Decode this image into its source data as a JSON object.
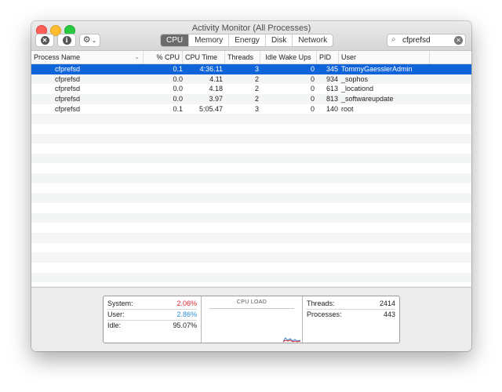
{
  "window": {
    "title": "Activity Monitor (All Processes)"
  },
  "toolbar": {
    "close_glyph": "✕",
    "info_glyph": "i",
    "gear_glyph": "⚙",
    "chevron_glyph": "⌄",
    "tabs": [
      {
        "label": "CPU",
        "active": true
      },
      {
        "label": "Memory",
        "active": false
      },
      {
        "label": "Energy",
        "active": false
      },
      {
        "label": "Disk",
        "active": false
      },
      {
        "label": "Network",
        "active": false
      }
    ],
    "search": {
      "value": "cfprefsd",
      "icon_glyph": "⌕",
      "clear_glyph": "✕"
    }
  },
  "table": {
    "columns": [
      "Process Name",
      "% CPU",
      "CPU Time",
      "Threads",
      "Idle Wake Ups",
      "PID",
      "User"
    ],
    "sort_glyph": "⌄",
    "rows": [
      {
        "name": "cfprefsd",
        "cpu": "0.1",
        "time": "4:36.11",
        "threads": "3",
        "idle": "0",
        "pid": "345",
        "user": "TommyGaesslerAdmin",
        "selected": true
      },
      {
        "name": "cfprefsd",
        "cpu": "0.0",
        "time": "4.11",
        "threads": "2",
        "idle": "0",
        "pid": "934",
        "user": "_sophos",
        "selected": false
      },
      {
        "name": "cfprefsd",
        "cpu": "0.0",
        "time": "4.18",
        "threads": "2",
        "idle": "0",
        "pid": "613",
        "user": "_locationd",
        "selected": false
      },
      {
        "name": "cfprefsd",
        "cpu": "0.0",
        "time": "3.97",
        "threads": "2",
        "idle": "0",
        "pid": "813",
        "user": "_softwareupdate",
        "selected": false
      },
      {
        "name": "cfprefsd",
        "cpu": "0.1",
        "time": "5:05.47",
        "threads": "3",
        "idle": "0",
        "pid": "140",
        "user": "root",
        "selected": false
      }
    ]
  },
  "stats": {
    "system_label": "System:",
    "system_value": "2.06%",
    "user_label": "User:",
    "user_value": "2.86%",
    "idle_label": "Idle:",
    "idle_value": "95.07%",
    "cpu_load_title": "CPU LOAD",
    "threads_label": "Threads:",
    "threads_value": "2414",
    "processes_label": "Processes:",
    "processes_value": "443"
  },
  "colors": {
    "selection": "#1064d9",
    "system": "#e0282c",
    "user": "#2a8fd6",
    "tab_active": "#6b6b6b"
  }
}
